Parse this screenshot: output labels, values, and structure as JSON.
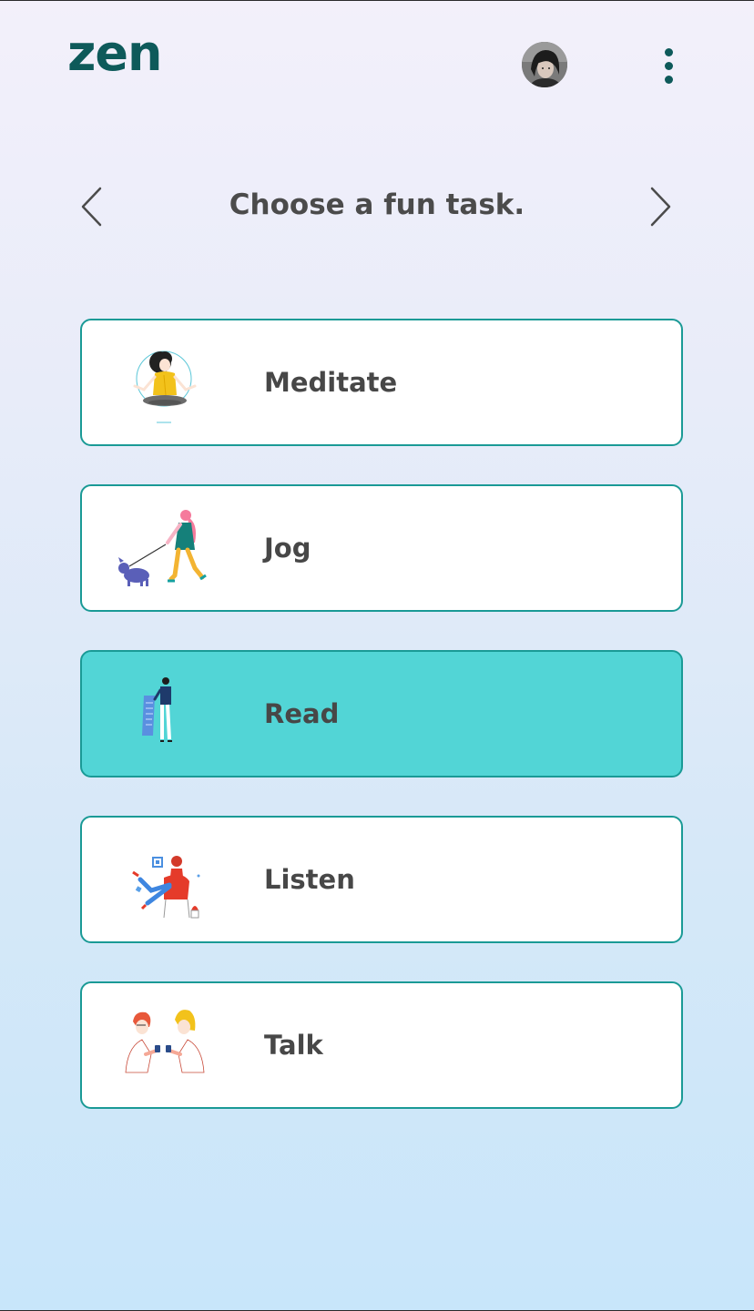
{
  "app": {
    "logo_text": "zen"
  },
  "header": {
    "avatar_icon": "user-avatar",
    "menu_icon": "more-vertical-icon"
  },
  "prompt": {
    "title": "Choose a fun task.",
    "prev_icon": "chevron-left-icon",
    "next_icon": "chevron-right-icon"
  },
  "tasks": [
    {
      "label": "Meditate",
      "icon": "meditate-illustration",
      "selected": false
    },
    {
      "label": "Jog",
      "icon": "jog-illustration",
      "selected": false
    },
    {
      "label": "Read",
      "icon": "read-illustration",
      "selected": true
    },
    {
      "label": "Listen",
      "icon": "listen-illustration",
      "selected": false
    },
    {
      "label": "Talk",
      "icon": "talk-illustration",
      "selected": false
    }
  ],
  "colors": {
    "brand": "#0e5a5a",
    "card_border": "#1a9a96",
    "selected_card": "#52d5d6",
    "text": "#474747"
  }
}
